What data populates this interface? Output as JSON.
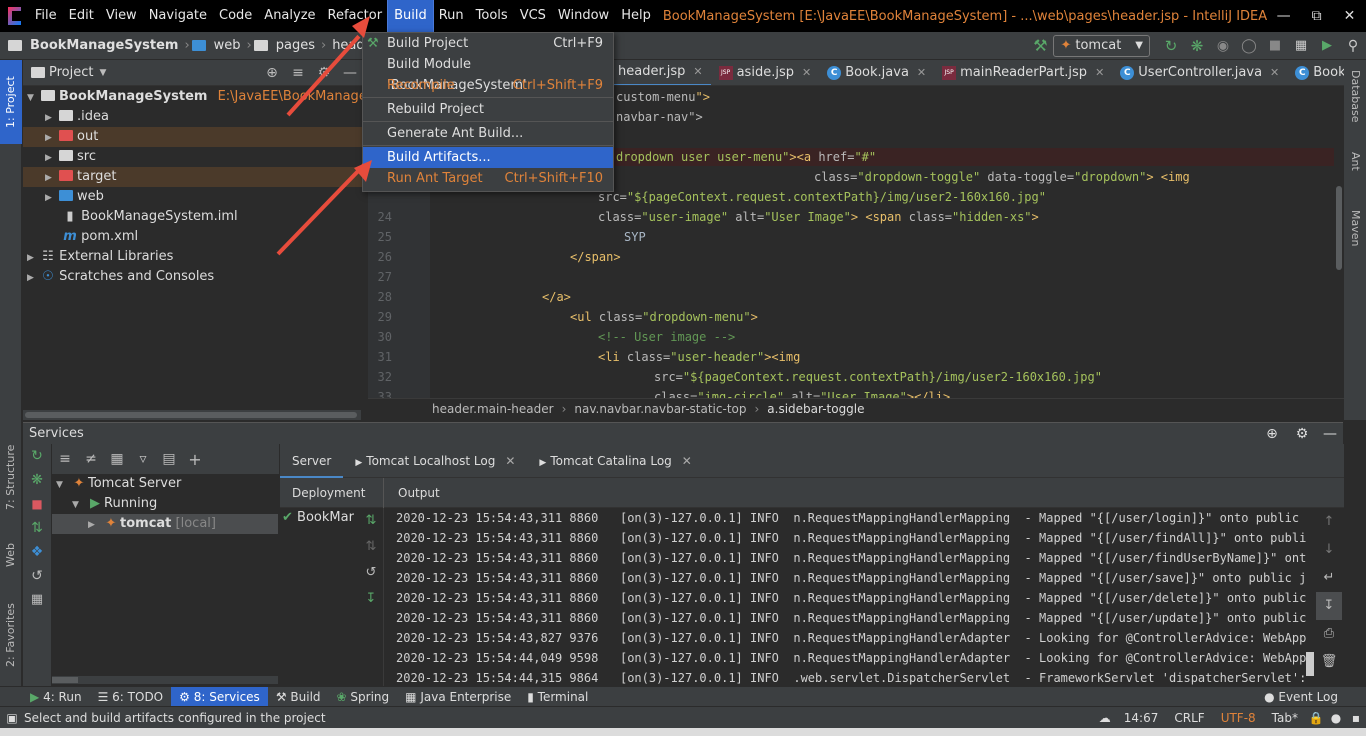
{
  "window": {
    "title": "BookManageSystem [E:\\JavaEE\\BookManageSystem] - ...\\web\\pages\\header.jsp - IntelliJ IDEA"
  },
  "menu": [
    "File",
    "Edit",
    "View",
    "Navigate",
    "Code",
    "Analyze",
    "Refactor",
    "Build",
    "Run",
    "Tools",
    "VCS",
    "Window",
    "Help"
  ],
  "nav": {
    "project": "BookManageSystem",
    "c1": "web",
    "c2": "pages",
    "c3": "header.jsp",
    "run_config": "tomcat"
  },
  "project_panel": {
    "title": "Project",
    "root": "BookManageSystem",
    "root_path": "E:\\JavaEE\\BookManageSystem",
    "items": [
      ".idea",
      "out",
      "src",
      "target",
      "web",
      "BookManageSystem.iml",
      "pom.xml",
      "External Libraries",
      "Scratches and Consoles"
    ]
  },
  "build_menu": {
    "items": [
      {
        "label": "Build Project",
        "shortcut": "Ctrl+F9"
      },
      {
        "label": "Build Module 'BookManageSystem'",
        "shortcut": ""
      },
      {
        "label": "Recompile",
        "shortcut": "Ctrl+Shift+F9"
      },
      {
        "label": "Rebuild Project",
        "shortcut": ""
      },
      {
        "label": "Generate Ant Build...",
        "shortcut": ""
      },
      {
        "label": "Build Artifacts...",
        "shortcut": ""
      },
      {
        "label": "Run Ant Target",
        "shortcut": "Ctrl+Shift+F10"
      }
    ]
  },
  "editor_tabs": [
    "header.jsp",
    "aside.jsp",
    "Book.java",
    "mainReaderPart.jsp",
    "UserController.java",
    "BookCon"
  ],
  "editor": {
    "lines": [
      {
        "n": "",
        "parts": [
          [
            "attr",
            "custom-menu"
          ],
          [
            "tag",
            "\">"
          ]
        ]
      },
      {
        "n": "",
        "parts": [
          [
            "attr",
            "navbar-nav\">"
          ]
        ]
      },
      {
        "n": "",
        "parts": []
      },
      {
        "n": "",
        "parts": [
          [
            "str",
            "dropdown user user-menu\""
          ],
          [
            "tag",
            ">"
          ],
          [
            "tag",
            "<a "
          ],
          [
            "attr",
            "href="
          ],
          [
            "str",
            "\"#\""
          ]
        ]
      },
      {
        "n": "",
        "parts": [
          [
            "attr",
            "class="
          ],
          [
            "str",
            "\"dropdown-toggle\" "
          ],
          [
            "attr",
            "data-toggle="
          ],
          [
            "str",
            "\"dropdown\""
          ],
          [
            "tag",
            "> <img"
          ]
        ]
      },
      {
        "n": "",
        "parts": [
          [
            "attr",
            "src="
          ],
          [
            "str",
            "\"${pageContext.request.contextPath}/img/user2-160x160.jpg\""
          ]
        ]
      },
      {
        "n": "24",
        "parts": [
          [
            "attr",
            "class="
          ],
          [
            "str",
            "\"user-image\" "
          ],
          [
            "attr",
            "alt="
          ],
          [
            "str",
            "\"User Image\""
          ],
          [
            "tag",
            "> <span "
          ],
          [
            "attr",
            "class="
          ],
          [
            "str",
            "\"hidden-xs\""
          ],
          [
            "tag",
            ">"
          ]
        ]
      },
      {
        "n": "25",
        "parts": [
          [
            "txt",
            "SYP"
          ]
        ]
      },
      {
        "n": "26",
        "parts": [
          [
            "tag",
            "</span>"
          ]
        ]
      },
      {
        "n": "27",
        "parts": []
      },
      {
        "n": "28",
        "parts": [
          [
            "tag",
            "</a>"
          ]
        ]
      },
      {
        "n": "29",
        "parts": [
          [
            "tag",
            "<ul "
          ],
          [
            "attr",
            "class="
          ],
          [
            "str",
            "\"dropdown-menu\""
          ],
          [
            "tag",
            ">"
          ]
        ]
      },
      {
        "n": "30",
        "parts": [
          [
            "cmt",
            "<!-- User image -->"
          ]
        ]
      },
      {
        "n": "31",
        "parts": [
          [
            "tag",
            "<li "
          ],
          [
            "attr",
            "class="
          ],
          [
            "str",
            "\"user-header\""
          ],
          [
            "tag",
            "><img"
          ]
        ]
      },
      {
        "n": "32",
        "parts": [
          [
            "attr",
            "src="
          ],
          [
            "str",
            "\"${pageContext.request.contextPath}/img/user2-160x160.jpg\""
          ]
        ]
      },
      {
        "n": "33",
        "parts": [
          [
            "attr",
            "class="
          ],
          [
            "str",
            "\"img-circle\" "
          ],
          [
            "attr",
            "alt="
          ],
          [
            "str",
            "\"User Image\""
          ],
          [
            "tag",
            "></li>"
          ]
        ]
      }
    ],
    "breadcrumb": [
      "header.main-header",
      "nav.navbar.navbar-static-top",
      "a.sidebar-toggle"
    ]
  },
  "services": {
    "title": "Services",
    "tree": [
      "Tomcat Server",
      "Running",
      "tomcat",
      "[local]"
    ],
    "tabs": [
      "Server",
      "Tomcat Localhost Log",
      "Tomcat Catalina Log"
    ],
    "deployment_label": "Deployment",
    "output_label": "Output",
    "deploy_item": "BookMar",
    "log": [
      "2020-12-23 15:54:43,311 8860   [on(3)-127.0.0.1] INFO  n.RequestMappingHandlerMapping  - Mapped \"{[/user/login]}\" onto public org.sp",
      "2020-12-23 15:54:43,311 8860   [on(3)-127.0.0.1] INFO  n.RequestMappingHandlerMapping  - Mapped \"{[/user/findAll]}\" onto public org.",
      "2020-12-23 15:54:43,311 8860   [on(3)-127.0.0.1] INFO  n.RequestMappingHandlerMapping  - Mapped \"{[/user/findUserByName]}\" onto publ",
      "2020-12-23 15:54:43,311 8860   [on(3)-127.0.0.1] INFO  n.RequestMappingHandlerMapping  - Mapped \"{[/user/save]}\" onto public java.la",
      "2020-12-23 15:54:43,311 8860   [on(3)-127.0.0.1] INFO  n.RequestMappingHandlerMapping  - Mapped \"{[/user/delete]}\" onto public java",
      "2020-12-23 15:54:43,311 8860   [on(3)-127.0.0.1] INFO  n.RequestMappingHandlerMapping  - Mapped \"{[/user/update]}\" onto public java",
      "2020-12-23 15:54:43,827 9376   [on(3)-127.0.0.1] INFO  n.RequestMappingHandlerAdapter  - Looking for @ControllerAdvice: WebApplicat",
      "2020-12-23 15:54:44,049 9598   [on(3)-127.0.0.1] INFO  n.RequestMappingHandlerAdapter  - Looking for @ControllerAdvice: WebApplica",
      "2020-12-23 15:54:44,315 9864   [on(3)-127.0.0.1] INFO  .web.servlet.DispatcherServlet  - FrameworkServlet 'dispatcherServlet': ini"
    ]
  },
  "left_tools": [
    "1: Project",
    "7: Structure",
    "Web",
    "2: Favorites"
  ],
  "right_tools": [
    "Database",
    "Ant",
    "Maven"
  ],
  "bottom_tabs": [
    "4: Run",
    "6: TODO",
    "8: Services",
    "Build",
    "Spring",
    "Java Enterprise",
    "Terminal"
  ],
  "event_log": "Event Log",
  "status": {
    "message": "Select and build artifacts configured in the project",
    "position": "14:67",
    "line_sep": "CRLF",
    "encoding": "UTF-8",
    "indent": "Tab*"
  },
  "colors": {
    "accent": "#2f65ca",
    "orange": "#e0833a",
    "arrow": "#e74c3c"
  }
}
